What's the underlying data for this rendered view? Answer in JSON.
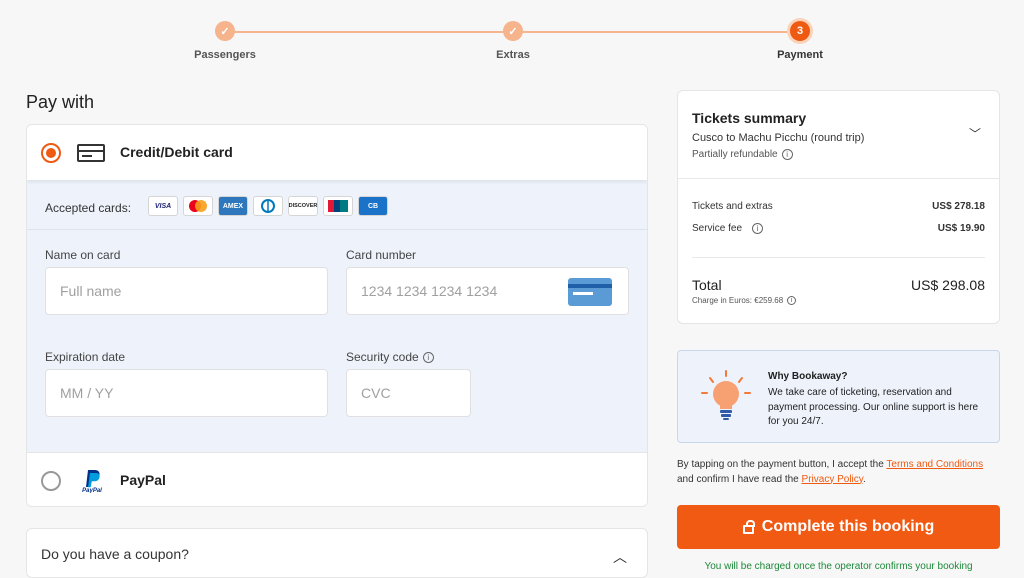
{
  "stepper": {
    "steps": [
      {
        "label": "Passengers",
        "state": "done",
        "mark": "✓"
      },
      {
        "label": "Extras",
        "state": "done",
        "mark": "✓"
      },
      {
        "label": "Payment",
        "state": "current",
        "mark": "3"
      }
    ]
  },
  "pay_with": {
    "title": "Pay with",
    "card_option": {
      "label": "Credit/Debit card",
      "selected": true
    },
    "accepted_cards_label": "Accepted cards:",
    "card_logos": [
      "VISA",
      "Mastercard",
      "AMEX",
      "Diners",
      "DISCOVER",
      "UnionPay",
      "CB"
    ],
    "name_label": "Name on card",
    "name_placeholder": "Full name",
    "number_label": "Card number",
    "number_placeholder": "1234 1234 1234 1234",
    "expiry_label": "Expiration date",
    "expiry_placeholder": "MM / YY",
    "cvc_label": "Security code",
    "cvc_placeholder": "CVC",
    "paypal_option": {
      "label": "PayPal",
      "selected": false
    }
  },
  "coupon": {
    "label": "Do you have a coupon?"
  },
  "summary": {
    "title": "Tickets summary",
    "route": "Cusco to Machu Picchu (round trip)",
    "refund": "Partially refundable",
    "tickets_label": "Tickets and extras",
    "tickets_value": "US$ 278.18",
    "fee_label": "Service fee",
    "fee_value": "US$ 19.90",
    "total_label": "Total",
    "total_value": "US$ 298.08",
    "charge_euros": "Charge in Euros: €259.68"
  },
  "why": {
    "title": "Why Bookaway?",
    "text": "We take care of ticketing, reservation and payment processing. Our online support is here for you 24/7."
  },
  "terms": {
    "prefix": "By tapping on the payment button, I accept the ",
    "terms_link": "Terms and Conditions",
    "middle": " and confirm I have read the ",
    "privacy_link": "Privacy Policy",
    "suffix": "."
  },
  "book_button": "Complete this booking",
  "charge_note": "You will be charged once the operator confirms your booking",
  "colors": {
    "accent": "#f15a13",
    "panel": "#eef3fb",
    "success": "#1c8a3a"
  }
}
